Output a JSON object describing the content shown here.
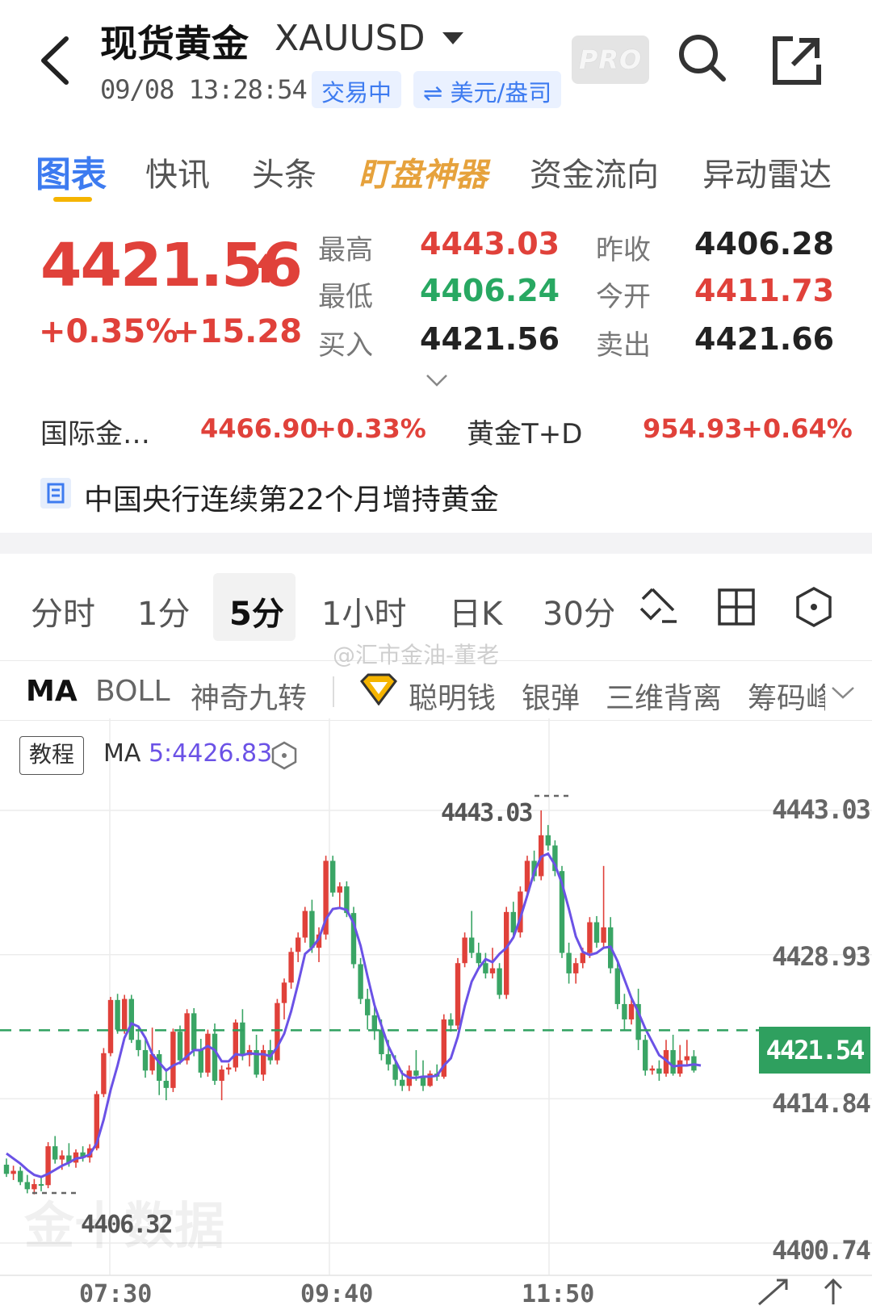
{
  "header": {
    "title": "现货黄金",
    "symbol": "XAUUSD",
    "timestamp": "09/08 13:28:54",
    "status_badge": "交易中",
    "unit_badge": "⇌ 美元/盎司",
    "pro_label": "PRO"
  },
  "tabs": [
    "图表",
    "快讯",
    "头条",
    "盯盘神器",
    "资金流向",
    "异动雷达"
  ],
  "quote": {
    "price": "4421.56",
    "change_pct": "+0.35%",
    "change_abs": "+15.28",
    "stats": {
      "high_label": "最高",
      "high": "4443.03",
      "low_label": "最低",
      "low": "4406.24",
      "bid_label": "买入",
      "bid": "4421.56",
      "prev_close_label": "昨收",
      "prev_close": "4406.28",
      "open_label": "今开",
      "open": "4411.73",
      "ask_label": "卖出",
      "ask": "4421.66"
    }
  },
  "related": {
    "intl_label": "国际金…",
    "intl_price": "4466.90",
    "intl_pct": "+0.33%",
    "td_label": "黄金T+D",
    "td_price": "954.93",
    "td_pct": "+0.64%"
  },
  "news": {
    "headline": "中国央行连续第22个月增持黄金"
  },
  "periods": [
    "分时",
    "1分",
    "5分",
    "1小时",
    "日K",
    "30分"
  ],
  "active_period": "5分",
  "indicators": [
    "MA",
    "BOLL",
    "神奇九转",
    "聪明钱",
    "银弹",
    "三维背离",
    "筹码峰"
  ],
  "watermark": "@汇市金油-董老",
  "chart": {
    "tutorial_label": "教程",
    "ma_prefix": "MA ",
    "ma_value": "5:4426.83",
    "high_note": "4443.03",
    "low_note": "4406.32",
    "last_price": "4421.54",
    "logo_watermark": "金十数据",
    "y_ticks": [
      "4443.03",
      "4428.93",
      "4414.84",
      "4400.74"
    ],
    "x_ticks": [
      "07:30",
      "09:40",
      "11:50"
    ],
    "colors": {
      "up": "#e0413a",
      "down": "#3aa565",
      "ma": "#6b52e6",
      "last": "#2fa05f"
    }
  },
  "chart_data": {
    "type": "candlestick",
    "ylim": [
      4400.74,
      4443.03
    ],
    "yticks": [
      4443.03,
      4428.93,
      4414.84,
      4400.74
    ],
    "xticks": [
      "07:30",
      "09:40",
      "11:50"
    ],
    "last_price": 4421.54,
    "high": 4443.03,
    "low": 4406.32,
    "ma5_last": 4426.83,
    "candles": [
      [
        4408.4,
        4409.0,
        4407.2,
        4407.5
      ],
      [
        4407.5,
        4408.3,
        4406.9,
        4407.8
      ],
      [
        4407.8,
        4408.2,
        4406.4,
        4406.7
      ],
      [
        4406.7,
        4407.4,
        4405.6,
        4406.0
      ],
      [
        4406.0,
        4407.0,
        4405.5,
        4406.5
      ],
      [
        4406.5,
        4407.3,
        4405.8,
        4406.4
      ],
      [
        4406.4,
        4410.6,
        4406.1,
        4410.2
      ],
      [
        4410.2,
        4411.2,
        4408.5,
        4408.9
      ],
      [
        4408.9,
        4409.8,
        4407.9,
        4409.3
      ],
      [
        4409.3,
        4410.5,
        4408.2,
        4408.6
      ],
      [
        4408.6,
        4409.9,
        4408.1,
        4409.6
      ],
      [
        4409.6,
        4410.2,
        4408.7,
        4409.1
      ],
      [
        4409.1,
        4410.4,
        4408.6,
        4410.0
      ],
      [
        4410.0,
        4415.6,
        4409.8,
        4415.3
      ],
      [
        4415.3,
        4419.8,
        4415.0,
        4419.3
      ],
      [
        4419.3,
        4424.8,
        4419.0,
        4424.5
      ],
      [
        4424.5,
        4425.1,
        4421.2,
        4421.6
      ],
      [
        4421.6,
        4425.0,
        4421.2,
        4424.6
      ],
      [
        4424.6,
        4425.0,
        4420.3,
        4420.6
      ],
      [
        4420.6,
        4421.7,
        4419.0,
        4419.6
      ],
      [
        4419.6,
        4420.9,
        4416.9,
        4417.6
      ],
      [
        4417.6,
        4421.8,
        4417.2,
        4419.2
      ],
      [
        4419.2,
        4419.6,
        4415.2,
        4416.6
      ],
      [
        4416.6,
        4417.8,
        4414.7,
        4415.9
      ],
      [
        4415.9,
        4421.7,
        4415.5,
        4421.4
      ],
      [
        4421.4,
        4422.0,
        4418.2,
        4418.6
      ],
      [
        4418.6,
        4423.6,
        4418.2,
        4423.2
      ],
      [
        4423.2,
        4423.7,
        4419.0,
        4419.6
      ],
      [
        4419.6,
        4420.7,
        4416.9,
        4417.4
      ],
      [
        4417.4,
        4421.6,
        4417.0,
        4421.2
      ],
      [
        4421.2,
        4422.2,
        4416.2,
        4416.6
      ],
      [
        4416.6,
        4418.1,
        4414.7,
        4417.7
      ],
      [
        4417.7,
        4418.3,
        4417.2,
        4417.9
      ],
      [
        4417.9,
        4422.6,
        4417.5,
        4422.3
      ],
      [
        4422.3,
        4423.6,
        4418.6,
        4419.1
      ],
      [
        4419.1,
        4420.1,
        4418.0,
        4419.6
      ],
      [
        4419.6,
        4421.1,
        4416.9,
        4417.2
      ],
      [
        4417.2,
        4420.1,
        4416.6,
        4419.6
      ],
      [
        4419.6,
        4420.6,
        4418.2,
        4418.6
      ],
      [
        4418.6,
        4424.6,
        4418.2,
        4424.2
      ],
      [
        4424.2,
        4426.6,
        4422.6,
        4426.2
      ],
      [
        4426.2,
        4429.6,
        4425.6,
        4429.2
      ],
      [
        4429.2,
        4431.1,
        4428.2,
        4430.6
      ],
      [
        4430.6,
        4433.6,
        4430.1,
        4433.2
      ],
      [
        4433.2,
        4434.3,
        4429.1,
        4429.6
      ],
      [
        4429.6,
        4431.6,
        4428.2,
        4430.9
      ],
      [
        4430.9,
        4438.6,
        4430.4,
        4438.1
      ],
      [
        4438.1,
        4438.6,
        4434.6,
        4435.0
      ],
      [
        4435.0,
        4436.0,
        4433.5,
        4435.6
      ],
      [
        4435.6,
        4436.1,
        4432.6,
        4433.0
      ],
      [
        4433.0,
        4433.6,
        4427.6,
        4428.0
      ],
      [
        4428.0,
        4428.6,
        4424.1,
        4424.6
      ],
      [
        4424.6,
        4425.6,
        4421.6,
        4423.0
      ],
      [
        4423.0,
        4424.1,
        4420.6,
        4421.6
      ],
      [
        4421.6,
        4422.6,
        4418.6,
        4419.2
      ],
      [
        4419.2,
        4420.6,
        4417.6,
        4418.2
      ],
      [
        4418.2,
        4419.1,
        4416.1,
        4416.7
      ],
      [
        4416.7,
        4417.6,
        4415.6,
        4416.1
      ],
      [
        4416.1,
        4418.1,
        4415.6,
        4417.6
      ],
      [
        4417.6,
        4419.6,
        4416.6,
        4417.1
      ],
      [
        4417.1,
        4418.6,
        4415.6,
        4416.1
      ],
      [
        4416.1,
        4417.6,
        4416.0,
        4417.3
      ],
      [
        4417.3,
        4418.2,
        4416.6,
        4417.0
      ],
      [
        4417.0,
        4423.1,
        4416.8,
        4422.6
      ],
      [
        4422.6,
        4423.2,
        4421.4,
        4422.0
      ],
      [
        4422.0,
        4428.6,
        4421.6,
        4428.1
      ],
      [
        4428.1,
        4431.1,
        4427.7,
        4430.6
      ],
      [
        4430.6,
        4433.2,
        4428.6,
        4429.1
      ],
      [
        4429.1,
        4430.1,
        4427.6,
        4428.1
      ],
      [
        4428.1,
        4429.1,
        4426.6,
        4427.1
      ],
      [
        4427.1,
        4429.6,
        4426.6,
        4427.6
      ],
      [
        4427.6,
        4428.1,
        4424.6,
        4425.0
      ],
      [
        4425.0,
        4433.6,
        4424.6,
        4433.1
      ],
      [
        4433.1,
        4434.1,
        4430.6,
        4431.1
      ],
      [
        4431.1,
        4435.6,
        4430.6,
        4435.1
      ],
      [
        4435.1,
        4438.6,
        4434.6,
        4438.1
      ],
      [
        4438.1,
        4439.1,
        4436.1,
        4436.6
      ],
      [
        4436.6,
        4443.03,
        4436.2,
        4440.6
      ],
      [
        4440.6,
        4441.6,
        4439.1,
        4439.6
      ],
      [
        4439.6,
        4440.1,
        4436.6,
        4437.1
      ],
      [
        4437.1,
        4437.6,
        4428.6,
        4429.1
      ],
      [
        4429.1,
        4430.1,
        4426.1,
        4427.1
      ],
      [
        4427.1,
        4428.6,
        4426.1,
        4428.1
      ],
      [
        4428.1,
        4429.6,
        4427.6,
        4429.1
      ],
      [
        4429.1,
        4432.6,
        4428.6,
        4432.1
      ],
      [
        4432.1,
        4432.7,
        4429.6,
        4430.1
      ],
      [
        4430.1,
        4437.6,
        4429.6,
        4431.6
      ],
      [
        4431.6,
        4432.6,
        4427.1,
        4427.6
      ],
      [
        4427.6,
        4428.1,
        4423.6,
        4424.1
      ],
      [
        4424.1,
        4425.1,
        4421.6,
        4422.6
      ],
      [
        4422.6,
        4424.6,
        4422.1,
        4424.1
      ],
      [
        4424.1,
        4425.6,
        4419.6,
        4420.6
      ],
      [
        4420.6,
        4421.1,
        4417.1,
        4417.6
      ],
      [
        4417.6,
        4418.1,
        4417.2,
        4417.8
      ],
      [
        4417.8,
        4418.6,
        4416.6,
        4417.3
      ],
      [
        4417.3,
        4420.6,
        4417.0,
        4419.6
      ],
      [
        4419.6,
        4421.1,
        4417.1,
        4417.3
      ],
      [
        4417.3,
        4420.1,
        4417.0,
        4418.6
      ],
      [
        4418.6,
        4420.6,
        4418.1,
        4419.0
      ],
      [
        4419.0,
        4419.6,
        4417.4,
        4417.6
      ]
    ],
    "ma5": [
      4409.5,
      4409.0,
      4408.5,
      4407.9,
      4407.4,
      4407.2,
      4407.5,
      4407.9,
      4408.3,
      4408.6,
      4409.0,
      4409.1,
      4409.4,
      4410.5,
      4412.8,
      4415.7,
      4418.1,
      4420.8,
      4422.2,
      4421.9,
      4420.8,
      4419.2,
      4418.4,
      4417.6,
      4418.1,
      4418.4,
      4419.0,
      4419.6,
      4419.6,
      4420.0,
      4419.6,
      4418.5,
      4418.5,
      4419.2,
      4419.1,
      4419.3,
      4419.2,
      4419.2,
      4419.0,
      4419.9,
      4421.2,
      4423.4,
      4426.1,
      4429.0,
      4429.6,
      4430.5,
      4432.4,
      4433.4,
      4433.5,
      4433.3,
      4432.0,
      4429.8,
      4426.8,
      4424.0,
      4422.0,
      4420.0,
      4418.6,
      4417.3,
      4416.9,
      4416.9,
      4417.0,
      4417.0,
      4417.1,
      4418.1,
      4418.8,
      4420.9,
      4423.9,
      4426.3,
      4427.6,
      4428.5,
      4428.2,
      4429.0,
      4429.6,
      4430.6,
      4432.5,
      4434.7,
      4437.0,
      4438.5,
      4438.8,
      4437.7,
      4435.9,
      4433.4,
      4430.7,
      4429.2,
      4428.9,
      4429.1,
      4429.6,
      4429.7,
      4428.3,
      4426.5,
      4424.7,
      4423.3,
      4421.7,
      4420.4,
      4419.1,
      4418.6,
      4418.0,
      4418.1,
      4418.1,
      4418.2,
      4418.1
    ]
  }
}
